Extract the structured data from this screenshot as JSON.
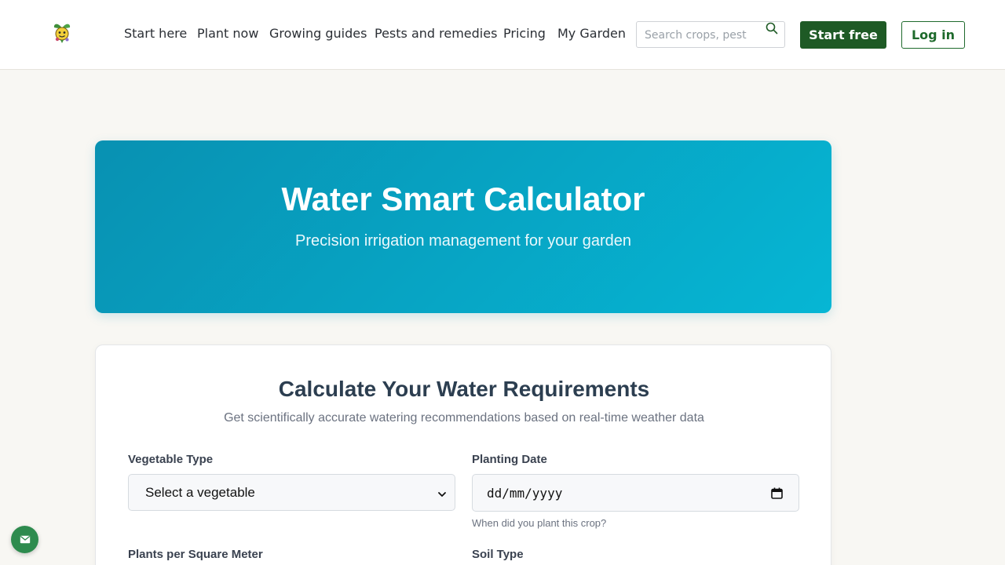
{
  "nav": {
    "links": [
      "Start here",
      "Plant now",
      "Growing guides",
      "Pests and remedies",
      "Pricing",
      "My Garden"
    ],
    "search_placeholder": "Search crops, pest",
    "start_free": "Start free",
    "login": "Log in",
    "brand_color": "#1e5a25",
    "icons": {
      "logo": "plant-mascot-icon",
      "search": "search-icon"
    }
  },
  "hero": {
    "title": "Water Smart Calculator",
    "subtitle": "Precision irrigation management for your garden",
    "gradient": [
      "#0891b2",
      "#06b6d4"
    ]
  },
  "calculator": {
    "title": "Calculate Your Water Requirements",
    "subtitle": "Get scientifically accurate watering recommendations based on real-time weather data",
    "fields": {
      "vegetable": {
        "label": "Vegetable Type",
        "value": "Select a vegetable"
      },
      "planting_date": {
        "label": "Planting Date",
        "value": "dd/mm/yyyy",
        "hint": "When did you plant this crop?"
      },
      "plants_per_sqm": {
        "label": "Plants per Square Meter"
      },
      "soil_type": {
        "label": "Soil Type"
      }
    }
  },
  "chat": {
    "icon": "mail-icon",
    "color": "#2e8b4e"
  }
}
